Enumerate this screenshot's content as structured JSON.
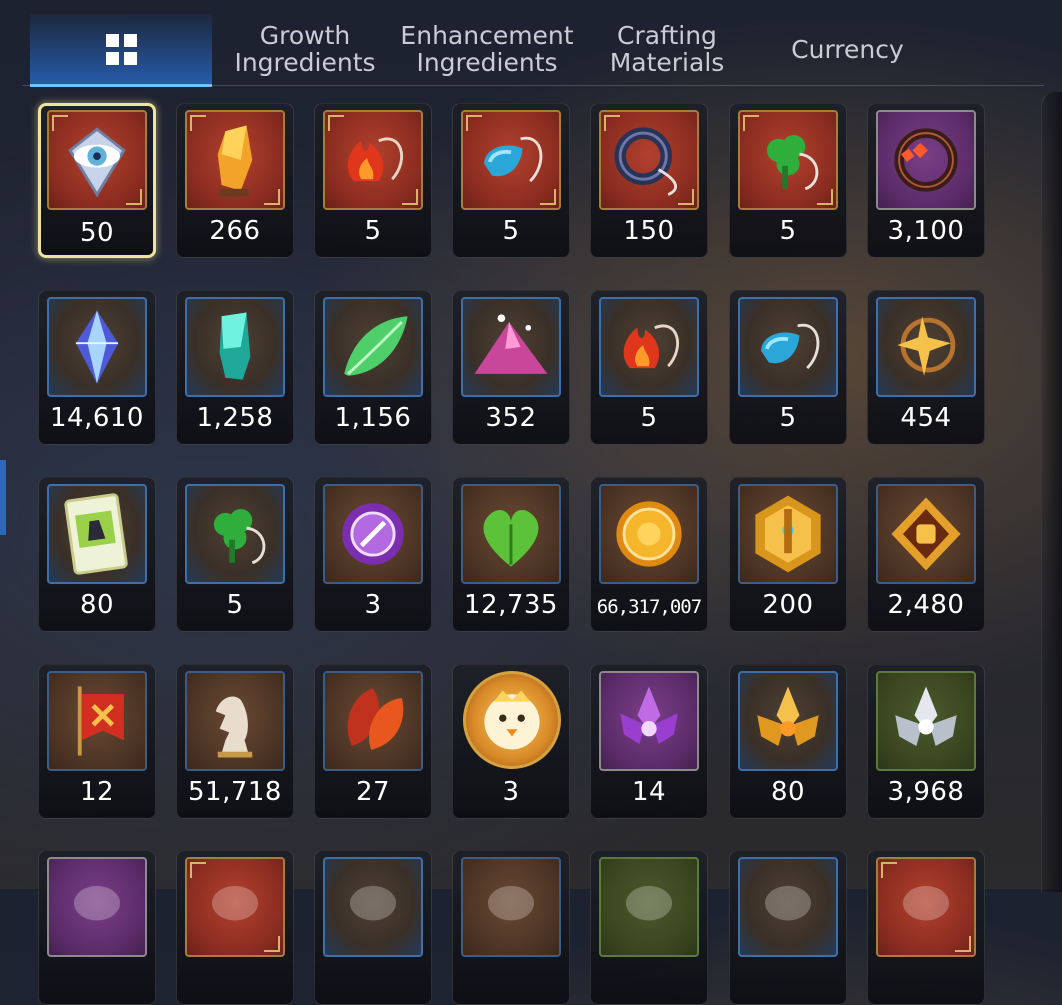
{
  "tabs": [
    {
      "id": "all",
      "label": "",
      "icon": "grid-icon",
      "active": true
    },
    {
      "id": "growth",
      "label": "Growth\nIngredients",
      "active": false
    },
    {
      "id": "enhancement",
      "label": "Enhancement\nIngredients",
      "active": false
    },
    {
      "id": "crafting",
      "label": "Crafting\nMaterials",
      "active": false
    },
    {
      "id": "currency",
      "label": "Currency",
      "active": false
    }
  ],
  "rows": [
    [
      {
        "name": "eye-emblem-icon",
        "qty": "50",
        "frame": "red",
        "selected": true
      },
      {
        "name": "amber-crystal-icon",
        "qty": "266",
        "frame": "red"
      },
      {
        "name": "fire-pendant-icon",
        "qty": "5",
        "frame": "red"
      },
      {
        "name": "water-pendant-icon",
        "qty": "5",
        "frame": "red"
      },
      {
        "name": "ring-pendant-icon",
        "qty": "150",
        "frame": "red"
      },
      {
        "name": "clover-pendant-icon",
        "qty": "5",
        "frame": "red"
      },
      {
        "name": "flower-ring-icon",
        "qty": "3,100",
        "frame": "purple"
      }
    ],
    [
      {
        "name": "blue-gem-icon",
        "qty": "14,610",
        "frame": "blue"
      },
      {
        "name": "teal-crystal-icon",
        "qty": "1,258",
        "frame": "blue"
      },
      {
        "name": "green-leaf-icon",
        "qty": "1,156",
        "frame": "blue"
      },
      {
        "name": "pink-mountain-icon",
        "qty": "352",
        "frame": "blue"
      },
      {
        "name": "fire-pendant-icon",
        "qty": "5",
        "frame": "blue"
      },
      {
        "name": "water-pendant-icon",
        "qty": "5",
        "frame": "blue"
      },
      {
        "name": "star-pendant-icon",
        "qty": "454",
        "frame": "blue"
      }
    ],
    [
      {
        "name": "costume-card-icon",
        "qty": "80",
        "frame": "blue"
      },
      {
        "name": "clover-pendant-icon",
        "qty": "5",
        "frame": "blue"
      },
      {
        "name": "purple-badge-icon",
        "qty": "3",
        "frame": "brown"
      },
      {
        "name": "green-heart-icon",
        "qty": "12,735",
        "frame": "brown"
      },
      {
        "name": "gold-coin-icon",
        "qty": "66,317,007",
        "frame": "brown",
        "small": true
      },
      {
        "name": "gold-hex-emblem-icon",
        "qty": "200",
        "frame": "brown"
      },
      {
        "name": "fist-emblem-icon",
        "qty": "2,480",
        "frame": "brown"
      }
    ],
    [
      {
        "name": "banner-flag-icon",
        "qty": "12",
        "frame": "brown"
      },
      {
        "name": "knight-chess-icon",
        "qty": "51,718",
        "frame": "brown"
      },
      {
        "name": "autumn-leaf-icon",
        "qty": "27",
        "frame": "brown"
      },
      {
        "name": "chick-portrait-icon",
        "qty": "3",
        "frame": "round"
      },
      {
        "name": "purple-lotus-icon",
        "qty": "14",
        "frame": "purple"
      },
      {
        "name": "gold-lotus-icon",
        "qty": "80",
        "frame": "blue"
      },
      {
        "name": "silver-lotus-icon",
        "qty": "3,968",
        "frame": "green"
      }
    ],
    [
      {
        "name": "partial-item-icon",
        "qty": "",
        "frame": "purple"
      },
      {
        "name": "partial-item-icon",
        "qty": "",
        "frame": "red"
      },
      {
        "name": "partial-item-icon",
        "qty": "",
        "frame": "blue"
      },
      {
        "name": "partial-item-icon",
        "qty": "",
        "frame": "brown"
      },
      {
        "name": "partial-item-icon",
        "qty": "",
        "frame": "green"
      },
      {
        "name": "partial-item-icon",
        "qty": "",
        "frame": "blue"
      },
      {
        "name": "partial-item-icon",
        "qty": "",
        "frame": "red"
      }
    ]
  ]
}
